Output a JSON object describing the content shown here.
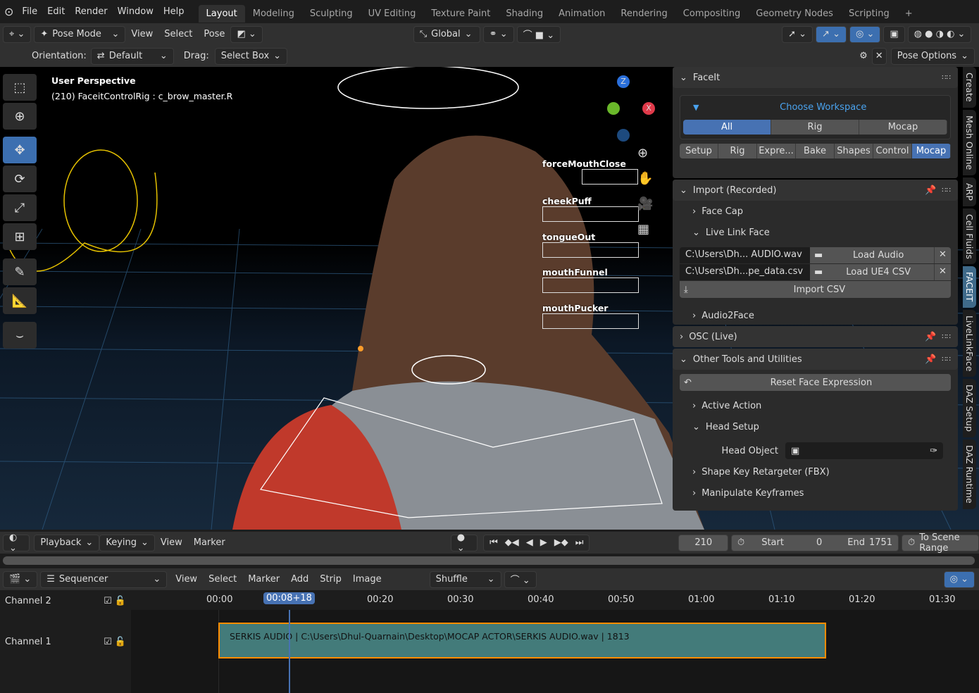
{
  "topbar": {
    "menu": [
      "File",
      "Edit",
      "Render",
      "Window",
      "Help"
    ],
    "workspaces": [
      "Layout",
      "Modeling",
      "Sculpting",
      "UV Editing",
      "Texture Paint",
      "Shading",
      "Animation",
      "Rendering",
      "Compositing",
      "Geometry Nodes",
      "Scripting"
    ],
    "active_workspace": "Layout",
    "add": "+"
  },
  "header": {
    "mode": "Pose Mode",
    "menus": [
      "View",
      "Select",
      "Pose"
    ],
    "transform": "Global"
  },
  "toolsettings": {
    "orientation_label": "Orientation:",
    "orientation": "Default",
    "drag_label": "Drag:",
    "drag": "Select Box",
    "pose_options": "Pose Options"
  },
  "viewport": {
    "perspective": "User Perspective",
    "object": "(210) FaceitControlRig : c_brow_master.R",
    "controls": [
      "forceMouthClose",
      "cheekPuff",
      "tongueOut",
      "mouthFunnel",
      "mouthPucker"
    ],
    "gizmo": {
      "z": "Z",
      "x": "X"
    }
  },
  "sidebar": {
    "faceit": {
      "title": "FaceIt",
      "choose": "Choose Workspace",
      "workspaces": [
        "All",
        "Rig",
        "Mocap"
      ],
      "active_ws": "All",
      "tabs": [
        "Setup",
        "Rig",
        "Expre...",
        "Bake",
        "Shapes",
        "Control",
        "Mocap"
      ],
      "active_tab": "Mocap"
    },
    "import": {
      "title": "Import (Recorded)",
      "face_cap": "Face Cap",
      "live_link": "Live Link Face",
      "audio_path": "C:\\Users\\Dh... AUDIO.wav",
      "load_audio": "Load Audio",
      "csv_path": "C:\\Users\\Dh...pe_data.csv",
      "load_csv": "Load UE4 CSV",
      "import_csv": "Import CSV",
      "audio2face": "Audio2Face"
    },
    "osc": {
      "title": "OSC (Live)"
    },
    "other": {
      "title": "Other Tools and Utilities",
      "reset": "Reset Face Expression",
      "active_action": "Active Action",
      "head_setup": "Head Setup",
      "head_object": "Head Object",
      "shape_key": "Shape Key Retargeter (FBX)",
      "manipulate": "Manipulate Keyframes"
    }
  },
  "vtabs": [
    "Create",
    "Mesh Online",
    "ARP",
    "Cell Fluids",
    "FACEIT",
    "LiveLinkFace",
    "DAZ Setup",
    "DAZ Runtime"
  ],
  "active_vtab": "FACEIT",
  "timeline": {
    "menus": [
      "Playback",
      "Keying",
      "View",
      "Marker"
    ],
    "current": "210",
    "start_label": "Start",
    "start": "0",
    "end_label": "End",
    "end": "1751",
    "scene_range": "To Scene Range"
  },
  "sequencer": {
    "editor": "Sequencer",
    "menus": [
      "View",
      "Select",
      "Marker",
      "Add",
      "Strip",
      "Image"
    ],
    "snap": "Shuffle",
    "ticks": [
      "00:00",
      "00:20",
      "00:30",
      "00:40",
      "00:50",
      "01:00",
      "01:10",
      "01:20",
      "01:30"
    ],
    "playhead": "00:08+18",
    "channels": [
      "Channel 2",
      "Channel 1"
    ],
    "strip": "SERKIS AUDIO | C:\\Users\\Dhul-Quarnain\\Desktop\\MOCAP ACTOR\\SERKIS AUDIO.wav | 1813"
  },
  "colors": {
    "accent": "#4772b3",
    "strip": "#437b7a",
    "strip_border": "#ff8c00",
    "link": "#4aa3ef"
  }
}
